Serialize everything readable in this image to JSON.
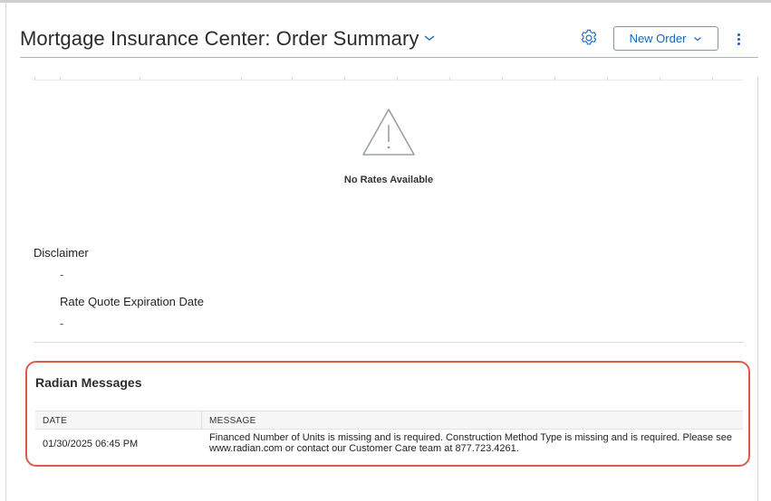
{
  "header": {
    "title": "Mortgage Insurance Center: Order Summary",
    "new_order_label": "New Order",
    "accent_color": "#1565c0"
  },
  "icons": {
    "title_dropdown": "chevron-down-icon",
    "settings": "gear-icon",
    "new_order_dropdown": "chevron-down-icon",
    "more_menu": "kebab-icon",
    "rates_status": "warning-triangle-icon"
  },
  "rates": {
    "empty_message": "No Rates Available"
  },
  "details": {
    "disclaimer_label": "Disclaimer",
    "disclaimer_value": "-",
    "expiration_label": "Rate Quote Expiration Date",
    "expiration_value": "-"
  },
  "messages": {
    "title": "Radian Messages",
    "highlight_color": "#e05a4a",
    "columns": [
      "DATE",
      "MESSAGE"
    ],
    "rows": [
      {
        "date": "01/30/2025 06:45 PM",
        "message": "Financed Number of Units is missing and is required. Construction Method Type is missing and is required. Please see www.radian.com or contact our Customer Care team at 877.723.4261."
      }
    ]
  }
}
